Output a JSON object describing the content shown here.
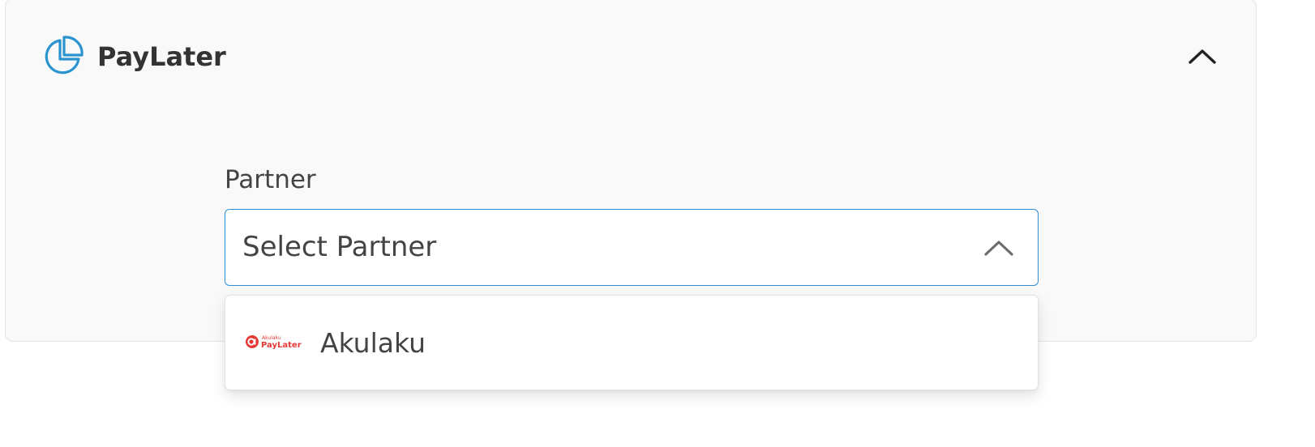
{
  "section": {
    "title": "PayLater",
    "icon": "pie-chart-icon",
    "collapse_icon": "chevron-up-icon",
    "accent_color": "#2a93d0"
  },
  "partner_field": {
    "label": "Partner",
    "placeholder": "Select Partner",
    "open_icon": "chevron-up-icon",
    "border_color": "#2e8fd6",
    "options": [
      {
        "label": "Akulaku",
        "logo_icon": "akulaku-paylater-logo",
        "logo_text_top": "Akulaku",
        "logo_text_bottom": "PayLater",
        "logo_color": "#e53935"
      }
    ]
  }
}
